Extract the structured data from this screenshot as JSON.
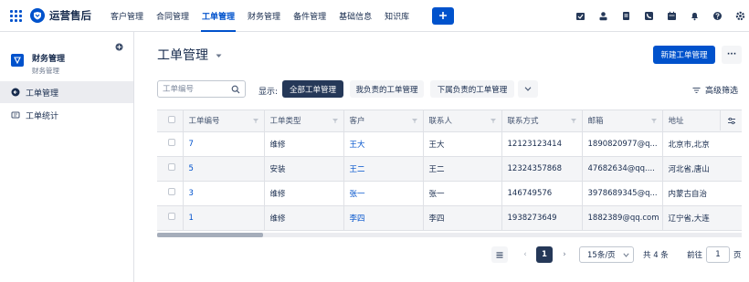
{
  "app": {
    "brand": "运营售后"
  },
  "nav": {
    "items": [
      "客户管理",
      "合同管理",
      "工单管理",
      "财务管理",
      "备件管理",
      "基础信息",
      "知识库"
    ],
    "active_index": 2
  },
  "sidebar": {
    "project_name": "财务管理",
    "project_sub": "财务管理",
    "items": [
      {
        "label": "工单管理",
        "icon": "arrow-left-circle-icon"
      },
      {
        "label": "工单统计",
        "icon": "list-icon"
      }
    ],
    "active_index": 0
  },
  "main": {
    "title": "工单管理",
    "new_button": "新建工单管理",
    "more_button": "···",
    "search_placeholder": "工单编号",
    "show_label": "显示:",
    "filters": [
      "全部工单管理",
      "我负责的工单管理",
      "下属负责的工单管理"
    ],
    "active_filter": 0,
    "advanced_filter": "高级筛选"
  },
  "table": {
    "columns": [
      "工单编号",
      "工单类型",
      "客户",
      "联系人",
      "联系方式",
      "邮箱",
      "地址"
    ],
    "rows": [
      [
        "7",
        "维修",
        "王大",
        "王大",
        "12123123414",
        "1890820977@q...",
        "北京市,北京"
      ],
      [
        "5",
        "安装",
        "王二",
        "王二",
        "12324357868",
        "47682634@qq....",
        "河北省,唐山"
      ],
      [
        "3",
        "维修",
        "张一",
        "张一",
        "146749576",
        "3978689345@q...",
        "内蒙古自治"
      ],
      [
        "1",
        "维修",
        "李四",
        "李四",
        "1938273649",
        "1882389@qq.com",
        "辽宁省,大连"
      ]
    ]
  },
  "pagination": {
    "prev": "‹",
    "current": "1",
    "next": "›",
    "page_size": "15条/页",
    "total": "共 4 条",
    "goto_label": "前往",
    "goto_value": "1",
    "page_unit": "页"
  },
  "colors": {
    "primary": "#0052cc",
    "dark": "#253858",
    "border": "#dfe1e6",
    "stripe": "#f4f5f7"
  }
}
